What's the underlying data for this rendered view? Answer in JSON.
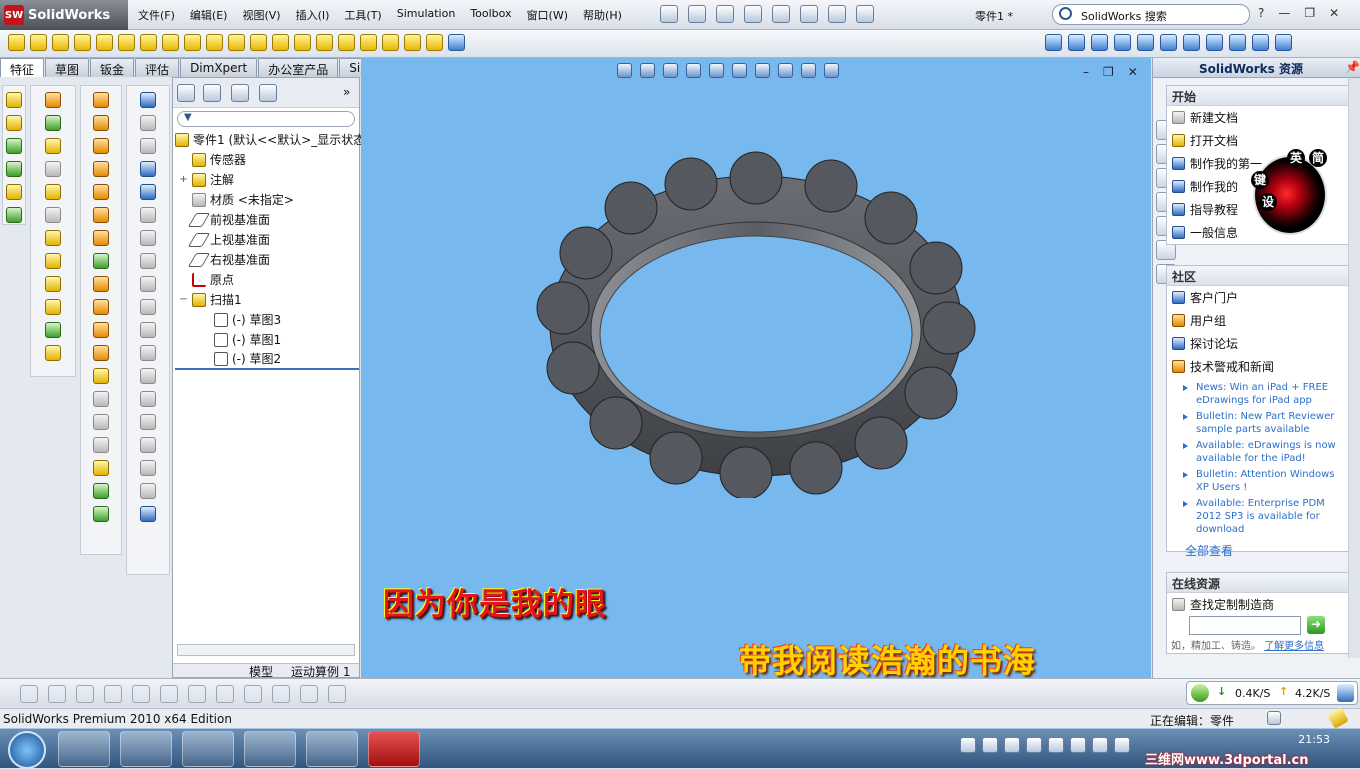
{
  "app": {
    "name": "SolidWorks",
    "logo_badge": "SW",
    "doc_title": "零件1 *",
    "search_placeholder": "SolidWorks 搜索"
  },
  "menus": [
    "文件(F)",
    "编辑(E)",
    "视图(V)",
    "插入(I)",
    "工具(T)",
    "Simulation",
    "Toolbox",
    "窗口(W)",
    "帮助(H)"
  ],
  "tabs": [
    "特征",
    "草图",
    "钣金",
    "评估",
    "DimXpert",
    "办公室产品",
    "Simulation"
  ],
  "tree": {
    "root": "零件1  (默认<<默认>_显示状态",
    "items": [
      {
        "label": "传感器",
        "expander": ""
      },
      {
        "label": "注解",
        "expander": "+"
      },
      {
        "label": "材质 <未指定>",
        "expander": ""
      },
      {
        "label": "前视基准面",
        "expander": ""
      },
      {
        "label": "上视基准面",
        "expander": ""
      },
      {
        "label": "右视基准面",
        "expander": ""
      },
      {
        "label": "原点",
        "expander": ""
      },
      {
        "label": "扫描1",
        "expander": "−"
      },
      {
        "label": "(-) 草图3",
        "expander": ""
      },
      {
        "label": "(-) 草图1",
        "expander": ""
      },
      {
        "label": "(-) 草图2",
        "expander": ""
      }
    ],
    "bottom_tabs": [
      "模型",
      "运动算例 1"
    ]
  },
  "viewport": {
    "caption1": "因为你是我的眼",
    "caption2": "带我阅读浩瀚的书海",
    "model": "sweep-ring"
  },
  "taskpane": {
    "title": "SolidWorks 资源",
    "start": {
      "header": "开始",
      "items": [
        "新建文档",
        "打开文档",
        "制作我的第一",
        "制作我的",
        "指导教程",
        "一般信息"
      ]
    },
    "community": {
      "header": "社区",
      "items": [
        "客户门户",
        "用户组",
        "探讨论坛",
        "技术警戒和新闻"
      ],
      "news": [
        "News: Win an iPad + FREE eDrawings for iPad app",
        "Bulletin: New Part Reviewer sample parts available",
        "Available: eDrawings is now available for the iPad!",
        "Bulletin: Attention Windows XP Users !",
        "Available: Enterprise PDM 2012 SP3 is available for download"
      ],
      "view_all": "全部查看"
    },
    "online": {
      "header": "在线资源",
      "items": [
        "查找定制制造商"
      ],
      "hint": "如，精加工、铸造。",
      "more": "了解更多信息"
    },
    "rose_chips": [
      "英",
      "简",
      "键",
      "设"
    ]
  },
  "netmon": {
    "down": "0.4K/S",
    "up": "4.2K/S"
  },
  "status": {
    "edition": "SolidWorks Premium 2010 x64 Edition",
    "editing": "正在编辑：零件"
  },
  "taskbar": {
    "time": "21:53",
    "site": "三维网www.3dportal.cn"
  },
  "colors": {
    "viewport": "#77b9ee",
    "model": "#575a60",
    "caption1": "#e0171e",
    "caption2": "#ffd200"
  }
}
